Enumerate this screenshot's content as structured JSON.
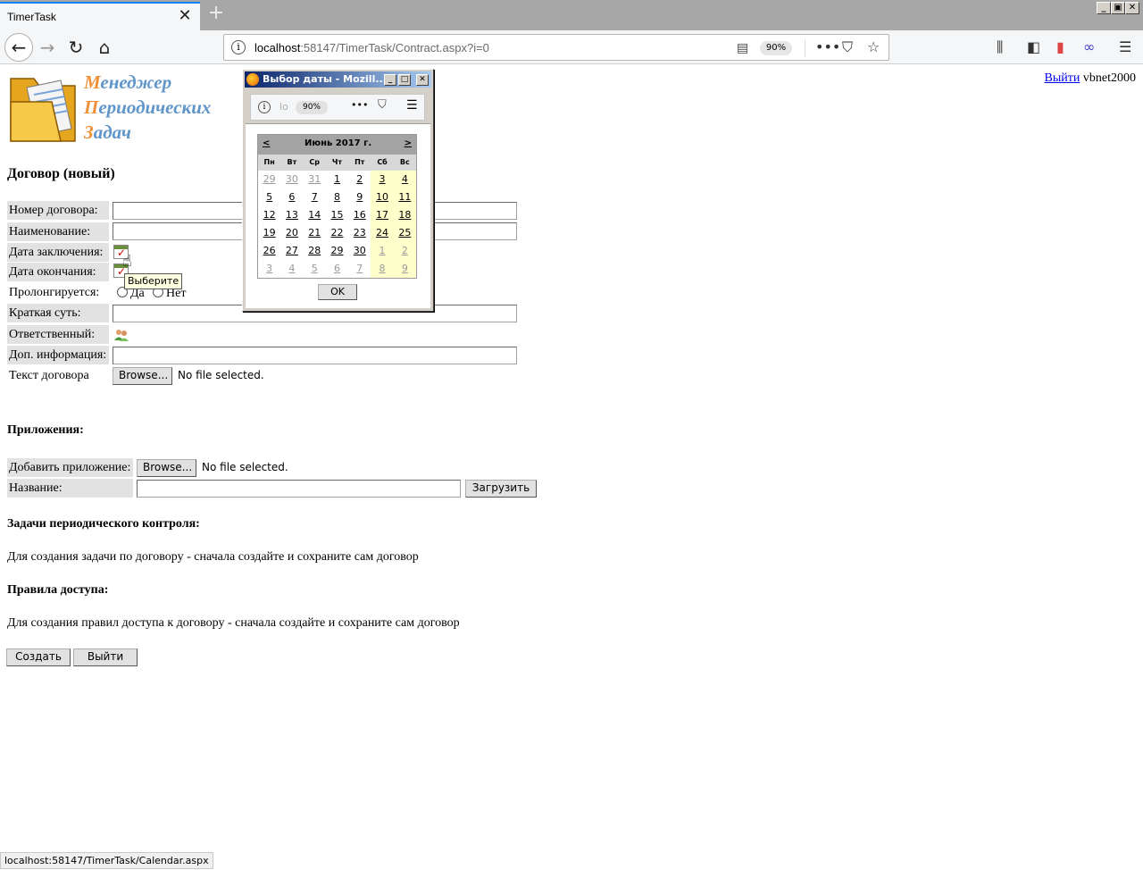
{
  "browser": {
    "tab_title": "TimerTask",
    "url_host": "localhost",
    "url_rest": ":58147/TimerTask/Contract.aspx?i=0",
    "zoom": "90%",
    "status_url": "localhost:58147/TimerTask/Calendar.aspx"
  },
  "logo": {
    "line1_cap": "М",
    "line1_rest": "енеджер",
    "line2_cap": "П",
    "line2_rest": "ериодических",
    "line3_cap": "З",
    "line3_rest": "адач"
  },
  "header": {
    "logout_link": "Выйти",
    "username": "vbnet2000"
  },
  "page_title": "Договор (новый)",
  "form": {
    "number_label": "Номер договора:",
    "name_label": "Наименование:",
    "date_signed_label": "Дата заключения:",
    "date_end_label": "Дата окончания:",
    "prolong_label": "Пролонгируется:",
    "prolong_yes": "Да",
    "prolong_no": "Нет",
    "summary_label": "Краткая суть:",
    "responsible_label": "Ответственный:",
    "extra_label": "Доп. информация:",
    "text_label": "Текст договора",
    "browse": "Browse...",
    "no_file": "No file selected."
  },
  "tooltip": "Выберите",
  "attachments": {
    "heading": "Приложения:",
    "add_label": "Добавить приложение:",
    "browse": "Browse...",
    "no_file": "No file selected.",
    "name_label": "Название:",
    "upload_button": "Загрузить"
  },
  "tasks": {
    "heading": "Задачи периодического контроля:",
    "note": "Для создания задачи по договору - сначала создайте и сохраните сам договор"
  },
  "access": {
    "heading": "Правила доступа:",
    "note": "Для создания правил доступа к договору - сначала создайте и сохраните сам договор"
  },
  "actions": {
    "create": "Создать",
    "exit": "Выйти"
  },
  "popup": {
    "title": "Выбор даты - Mozill...",
    "zoom": "90%",
    "url_hint": "lo",
    "prev": "<",
    "next": ">",
    "month_title": "Июнь 2017 г.",
    "weekdays": [
      "Пн",
      "Вт",
      "Ср",
      "Чт",
      "Пт",
      "Сб",
      "Вс"
    ],
    "weeks": [
      [
        "29",
        "30",
        "31",
        "1",
        "2",
        "3",
        "4"
      ],
      [
        "5",
        "6",
        "7",
        "8",
        "9",
        "10",
        "11"
      ],
      [
        "12",
        "13",
        "14",
        "15",
        "16",
        "17",
        "18"
      ],
      [
        "19",
        "20",
        "21",
        "22",
        "23",
        "24",
        "25"
      ],
      [
        "26",
        "27",
        "28",
        "29",
        "30",
        "1",
        "2"
      ],
      [
        "3",
        "4",
        "5",
        "6",
        "7",
        "8",
        "9"
      ]
    ],
    "ok": "OK"
  }
}
